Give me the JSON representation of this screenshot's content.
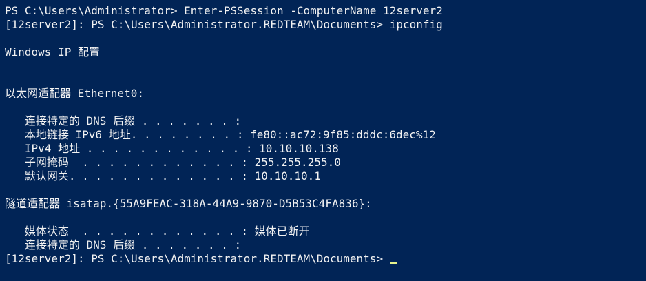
{
  "lines": [
    "PS C:\\Users\\Administrator> Enter-PSSession -ComputerName 12server2",
    "[12server2]: PS C:\\Users\\Administrator.REDTEAM\\Documents> ipconfig",
    "",
    "Windows IP 配置",
    "",
    "",
    "以太网适配器 Ethernet0:",
    "",
    "   连接特定的 DNS 后缀 . . . . . . . :",
    "   本地链接 IPv6 地址. . . . . . . . : fe80::ac72:9f85:dddc:6dec%12",
    "   IPv4 地址 . . . . . . . . . . . . : 10.10.10.138",
    "   子网掩码  . . . . . . . . . . . . : 255.255.255.0",
    "   默认网关. . . . . . . . . . . . . : 10.10.10.1",
    "",
    "隧道适配器 isatap.{55A9FEAC-318A-44A9-9870-D5B53C4FA836}:",
    "",
    "   媒体状态  . . . . . . . . . . . . : 媒体已断开",
    "   连接特定的 DNS 后缀 . . . . . . . :"
  ],
  "prompt": "[12server2]: PS C:\\Users\\Administrator.REDTEAM\\Documents>",
  "colors": {
    "background": "#012456",
    "foreground": "#f2f2f2",
    "cursor": "#e6f28c"
  }
}
